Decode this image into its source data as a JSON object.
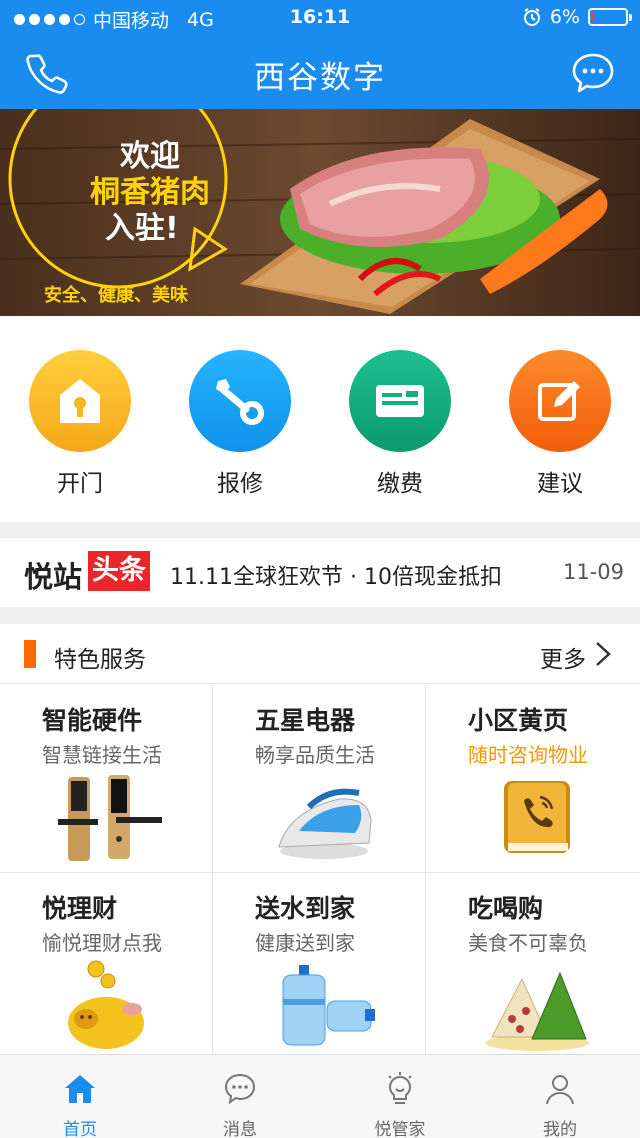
{
  "status_bar": {
    "carrier": "中国移动",
    "network": "4G",
    "time": "16:11",
    "battery": "6%",
    "battery_level": 0.06
  },
  "header": {
    "title": "西谷数字",
    "left_icon": "phone-icon",
    "right_icon": "chat-bubble-icon"
  },
  "banner": {
    "line1": "欢迎",
    "line2": "桐香猪肉",
    "line3": "入驻!",
    "slogan": "安全、健康、美味"
  },
  "quick_actions": [
    {
      "label": "开门",
      "icon": "house-lock-icon",
      "color": "#f8b71a"
    },
    {
      "label": "报修",
      "icon": "wrench-icon",
      "color": "#17a2f2"
    },
    {
      "label": "缴费",
      "icon": "card-icon",
      "color": "#12b07f"
    },
    {
      "label": "建议",
      "icon": "edit-icon",
      "color": "#ff6d12"
    }
  ],
  "news": {
    "brand": "悦站",
    "tag": "头条",
    "headline": "11.11全球狂欢节 · 10倍现金抵扣",
    "date": "11-09"
  },
  "services": {
    "title": "特色服务",
    "more": "更多",
    "items": [
      {
        "title": "智能硬件",
        "subtitle": "智慧链接生活"
      },
      {
        "title": "五星电器",
        "subtitle": "畅享品质生活"
      },
      {
        "title": "小区黄页",
        "subtitle": "随时咨询物业"
      },
      {
        "title": "悦理财",
        "subtitle": "愉悦理财点我"
      },
      {
        "title": "送水到家",
        "subtitle": "健康送到家"
      },
      {
        "title": "吃喝购",
        "subtitle": "美食不可辜负"
      }
    ]
  },
  "tabbar": [
    {
      "label": "首页",
      "icon": "home-icon",
      "active": true
    },
    {
      "label": "消息",
      "icon": "message-icon",
      "active": false
    },
    {
      "label": "悦管家",
      "icon": "butler-bulb-icon",
      "active": false
    },
    {
      "label": "我的",
      "icon": "profile-icon",
      "active": false
    }
  ],
  "colors": {
    "brand_blue": "#1a8cf0",
    "accent_orange": "#ff6a00",
    "tag_red": "#e8262b",
    "highlight_yellow": "#ffd400"
  }
}
